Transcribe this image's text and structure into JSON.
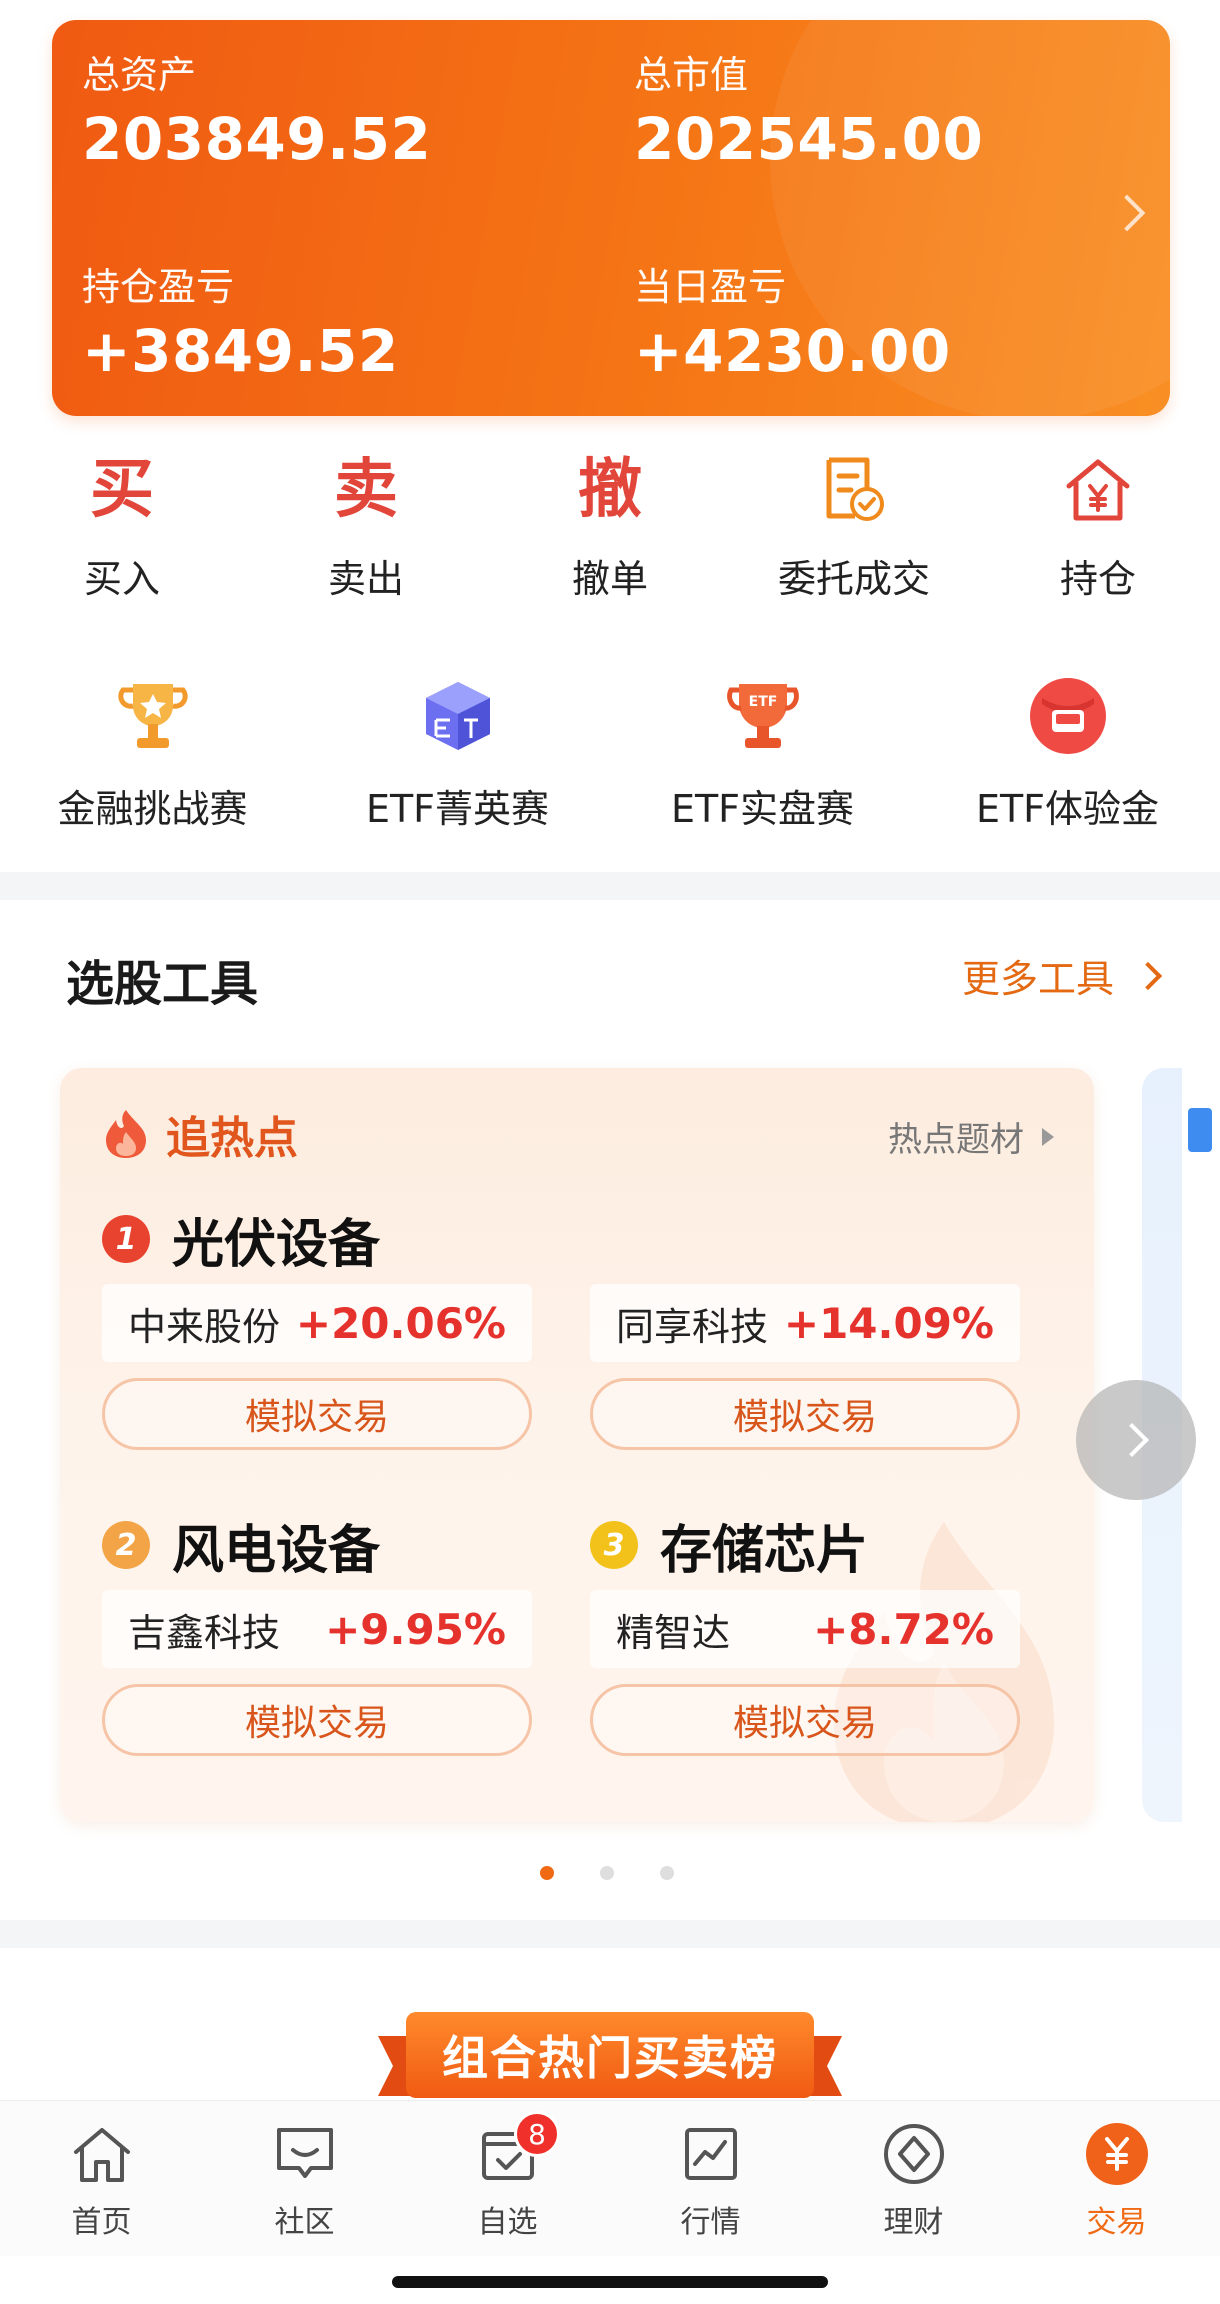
{
  "assets": {
    "total_assets_label": "总资产",
    "total_assets_value": "203849.52",
    "market_value_label": "总市值",
    "market_value_value": "202545.00",
    "position_pl_label": "持仓盈亏",
    "position_pl_value": "+3849.52",
    "daily_pl_label": "当日盈亏",
    "daily_pl_value": "+4230.00"
  },
  "quick_actions": [
    {
      "glyph": "买",
      "label": "买入"
    },
    {
      "glyph": "卖",
      "label": "卖出"
    },
    {
      "glyph": "撤",
      "label": "撤单"
    },
    {
      "icon": "document-check-icon",
      "label": "委托成交"
    },
    {
      "icon": "house-yen-icon",
      "label": "持仓"
    }
  ],
  "competitions": [
    {
      "icon": "trophy-star-icon",
      "label": "金融挑战赛"
    },
    {
      "icon": "etf-cube-icon",
      "label": "ETF菁英赛"
    },
    {
      "icon": "etf-trophy-icon",
      "label": "ETF实盘赛",
      "icon_text": "ETF"
    },
    {
      "icon": "red-envelope-icon",
      "label": "ETF体验金"
    }
  ],
  "stock_tools": {
    "title": "选股工具",
    "more": "更多工具"
  },
  "hot_card": {
    "title": "追热点",
    "link": "热点题材",
    "groups": [
      {
        "rank": "1",
        "name": "光伏设备",
        "stock": "中来股份",
        "change": "+20.06%",
        "button": "模拟交易"
      },
      {
        "name_hidden": true,
        "stock": "同享科技",
        "change": "+14.09%",
        "button": "模拟交易"
      },
      {
        "rank": "2",
        "name": "风电设备",
        "stock": "吉鑫科技",
        "change": "+9.95%",
        "button": "模拟交易"
      },
      {
        "rank": "3",
        "name": "存储芯片",
        "stock": "精智达",
        "change": "+8.72%",
        "button": "模拟交易"
      }
    ]
  },
  "ranking_banner": "组合热门买卖榜",
  "tabbar": {
    "tabs": [
      {
        "label": "首页",
        "icon": "home-icon"
      },
      {
        "label": "社区",
        "icon": "chat-icon"
      },
      {
        "label": "自选",
        "icon": "watchlist-icon",
        "badge": "8"
      },
      {
        "label": "行情",
        "icon": "chart-icon"
      },
      {
        "label": "理财",
        "icon": "diamond-icon"
      },
      {
        "label": "交易",
        "icon": "yen-circle-icon",
        "active": true
      }
    ]
  },
  "colors": {
    "brand_orange": "#f06a14",
    "gain_red": "#e5322d",
    "icon_red": "#e2463a"
  }
}
